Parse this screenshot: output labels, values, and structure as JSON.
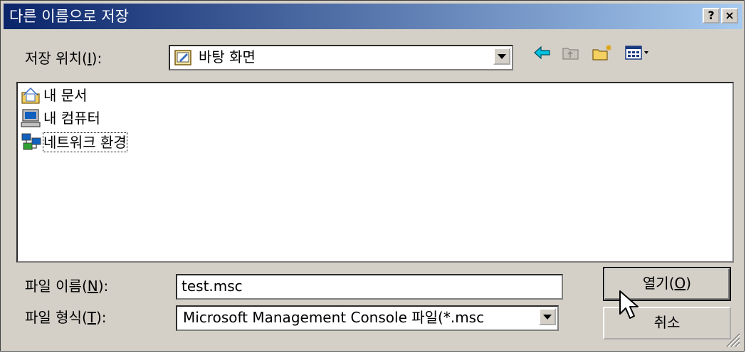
{
  "window": {
    "title": "다른 이름으로 저장",
    "help_button": "?",
    "close_button": "×"
  },
  "save_location": {
    "label_pre": "저장 위치(",
    "label_key": "I",
    "label_post": "):",
    "value": "바탕 화면"
  },
  "toolbar": {
    "icons": [
      "back-arrow-icon",
      "up-folder-icon",
      "new-folder-icon",
      "view-menu-icon"
    ]
  },
  "file_list": {
    "items": [
      {
        "label": "내 문서",
        "icon": "my-documents-icon"
      },
      {
        "label": "내 컴퓨터",
        "icon": "my-computer-icon"
      },
      {
        "label": "네트워크 환경",
        "icon": "network-places-icon"
      }
    ]
  },
  "file_name": {
    "label_pre": "파일 이름(",
    "label_key": "N",
    "label_post": "):",
    "value": "test.msc"
  },
  "file_type": {
    "label_pre": "파일 형식(",
    "label_key": "T",
    "label_post": "):",
    "value": "Microsoft Management Console 파일(*.msc"
  },
  "buttons": {
    "open_pre": "열기(",
    "open_key": "O",
    "open_post": ")",
    "cancel": "취소"
  },
  "colors": {
    "title_start": "#0a246a",
    "title_end": "#a6caf0",
    "dialog_face": "#d4d0c8"
  }
}
